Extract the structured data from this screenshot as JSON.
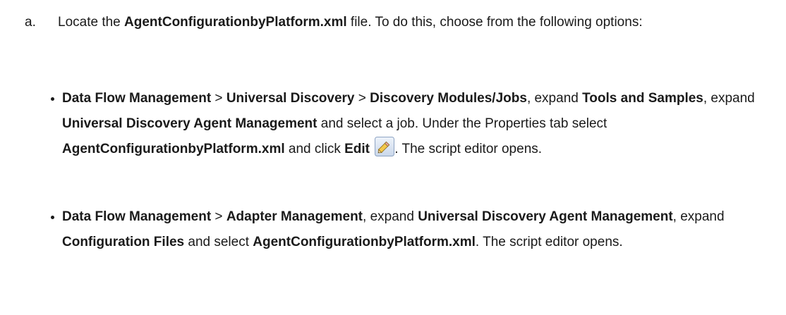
{
  "step": {
    "marker": "a.",
    "part1": "Locate the ",
    "file": "AgentConfigurationbyPlatform.xml",
    "part2": " file. To do this, choose from the following options:"
  },
  "options": [
    {
      "path1": "Data Flow Management",
      "sep1": " > ",
      "path2": "Universal Discovery",
      "sep2": " > ",
      "path3": "Discovery Modules/Jobs",
      "t1": ", expand ",
      "b1": "Tools and Samples",
      "t2": ", expand ",
      "b2": "Universal Discovery Agent Management",
      "t3": " and select a job. Under the Properties tab select ",
      "b3": "AgentConfigurationbyPlatform.xml",
      "t4": " and click ",
      "b4": "Edit",
      "t5": ". The script editor opens.",
      "icon": "pencil-edit-icon"
    },
    {
      "path1": "Data Flow Management",
      "sep1": " > ",
      "path2": "Adapter Management",
      "t1": ", expand ",
      "b1": "Universal Discovery Agent Management",
      "t2": ", expand ",
      "b2": "Configuration Files",
      "t3": " and select ",
      "b3": "AgentConfigurationbyPlatform.xml",
      "t4": ". The script editor opens."
    }
  ]
}
